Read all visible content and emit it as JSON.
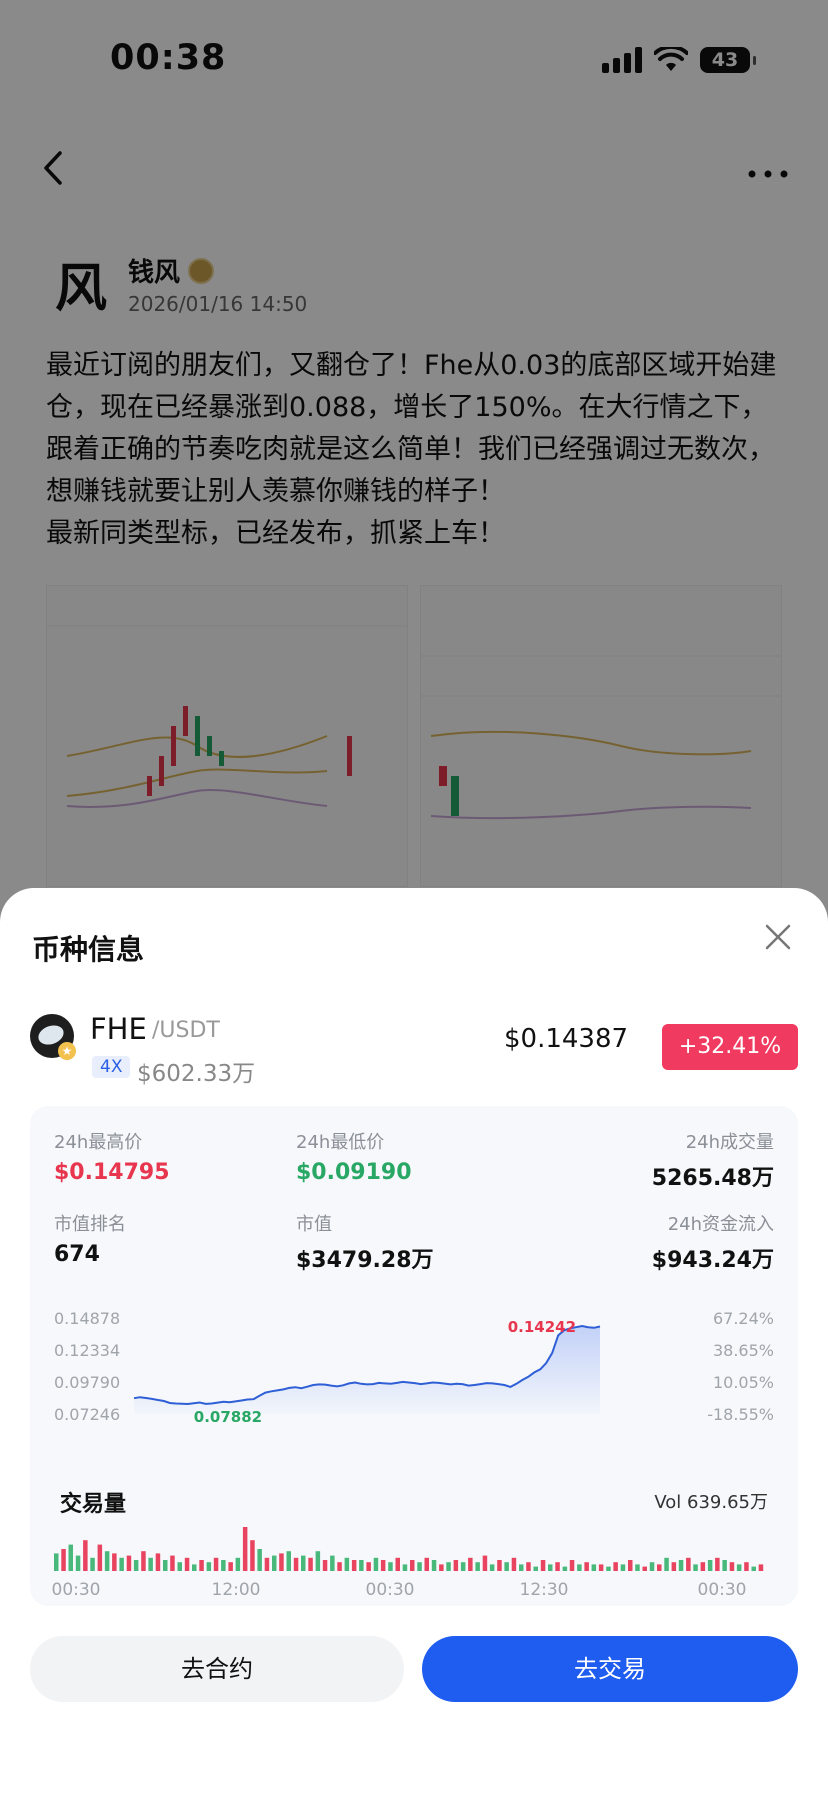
{
  "status_bar": {
    "time": "00:38",
    "battery": "43"
  },
  "post": {
    "author": "钱风",
    "avatar_char": "风",
    "date": "2026/01/16 14:50",
    "paragraph1": "最近订阅的朋友们，又翻仓了！Fhe从0.03的底部区域开始建仓，现在已经暴涨到0.088，增长了150%。在大行情之下，跟着正确的节奏吃肉就是这么简单！我们已经强调过无数次，想赚钱就要让别人羡慕你赚钱的样子！",
    "paragraph2": "最新同类型标，已经发布，抓紧上车！"
  },
  "sheet": {
    "title": "币种信息",
    "coin": {
      "name": "FHE",
      "pair": "/USDT",
      "leverage": "4X",
      "market_cap_short": "$602.33万",
      "price": "$0.14387",
      "change": "+32.41%"
    },
    "stats": {
      "high_label": "24h最高价",
      "high_value": "$0.14795",
      "low_label": "24h最低价",
      "low_value": "$0.09190",
      "volume_label": "24h成交量",
      "volume_value": "5265.48万",
      "rank_label": "市值排名",
      "rank_value": "674",
      "mcap_label": "市值",
      "mcap_value": "$3479.28万",
      "inflow_label": "24h资金流入",
      "inflow_value": "$943.24万"
    },
    "volume_title": "交易量",
    "volume_value": "Vol 639.65万",
    "buttons": {
      "contract": "去合约",
      "trade": "去交易"
    }
  },
  "chart_data": [
    {
      "type": "area",
      "ylim": [
        0.07246,
        0.14878
      ],
      "y_ticks": [
        "0.14878",
        "0.12334",
        "0.09790",
        "0.07246"
      ],
      "y_ticks_right": [
        "67.24%",
        "38.65%",
        "10.05%",
        "-18.55%"
      ],
      "annotations": {
        "max": "0.14242",
        "min": "0.07882"
      },
      "values": [
        0.085,
        0.0858,
        0.0852,
        0.0845,
        0.0836,
        0.0828,
        0.0812,
        0.0808,
        0.0806,
        0.0804,
        0.081,
        0.0816,
        0.0805,
        0.0808,
        0.0815,
        0.0822,
        0.0818,
        0.0825,
        0.0832,
        0.084,
        0.0842,
        0.087,
        0.0895,
        0.0905,
        0.0912,
        0.092,
        0.0932,
        0.0938,
        0.093,
        0.0942,
        0.0955,
        0.096,
        0.0958,
        0.095,
        0.0944,
        0.0953,
        0.0968,
        0.0975,
        0.0965,
        0.096,
        0.0962,
        0.0972,
        0.0968,
        0.0965,
        0.0972,
        0.098,
        0.0975,
        0.097,
        0.0962,
        0.0968,
        0.0975,
        0.0972,
        0.0966,
        0.096,
        0.0965,
        0.0962,
        0.095,
        0.0955,
        0.0962,
        0.097,
        0.0968,
        0.0962,
        0.0955,
        0.094,
        0.0965,
        0.0995,
        0.102,
        0.1055,
        0.108,
        0.113,
        0.121,
        0.135,
        0.139,
        0.1405,
        0.1415,
        0.1424,
        0.1415,
        0.141,
        0.142
      ]
    },
    {
      "type": "bar",
      "x_ticks": [
        "00:30",
        "12:00",
        "00:30",
        "12:30",
        "00:30"
      ],
      "values": [
        8,
        10,
        12,
        7,
        14,
        6,
        12,
        9,
        8,
        6,
        7,
        5,
        9,
        6,
        8,
        5,
        7,
        4,
        6,
        3,
        5,
        4,
        6,
        5,
        4,
        6,
        20,
        14,
        10,
        6,
        7,
        8,
        9,
        6,
        7,
        6,
        9,
        5,
        7,
        4,
        6,
        5,
        5,
        4,
        6,
        5,
        4,
        6,
        3,
        5,
        4,
        6,
        5,
        3,
        4,
        5,
        4,
        6,
        4,
        7,
        3,
        5,
        4,
        6,
        3,
        4,
        2,
        5,
        3,
        4,
        2,
        5,
        3,
        4,
        3,
        3,
        2,
        4,
        3,
        5,
        3,
        2,
        4,
        3,
        6,
        4,
        5,
        6,
        3,
        4,
        5,
        6,
        5,
        4,
        3,
        4,
        2,
        3
      ],
      "up": [
        1,
        0,
        1,
        1,
        0,
        1,
        0,
        1,
        0,
        1,
        0,
        1,
        0,
        1,
        0,
        1,
        0,
        1,
        0,
        1,
        0,
        1,
        0,
        1,
        0,
        1,
        0,
        0,
        1,
        0,
        1,
        0,
        1,
        0,
        1,
        0,
        1,
        0,
        1,
        0,
        1,
        0,
        1,
        0,
        1,
        0,
        1,
        0,
        1,
        0,
        1,
        0,
        1,
        0,
        1,
        0,
        1,
        0,
        1,
        0,
        1,
        0,
        1,
        0,
        1,
        0,
        1,
        0,
        1,
        0,
        1,
        0,
        1,
        0,
        1,
        0,
        1,
        0,
        1,
        0,
        1,
        0,
        1,
        0,
        1,
        0,
        1,
        0,
        1,
        0,
        1,
        0,
        1,
        0,
        1,
        0,
        1,
        0
      ]
    }
  ]
}
